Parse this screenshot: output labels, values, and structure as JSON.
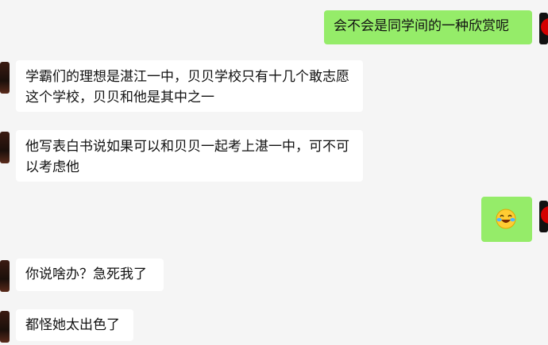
{
  "chat": {
    "messages": [
      {
        "side": "right",
        "text": "会不会是同学间的一种欣赏呢"
      },
      {
        "side": "left",
        "text": "学霸们的理想是湛江一中，贝贝学校只有十几个敢志愿这个学校，贝贝和他是其中之一"
      },
      {
        "side": "left",
        "text": "他写表白书说如果可以和贝贝一起考上湛一中，可不可以考虑他"
      },
      {
        "side": "right",
        "emoji": "laughing-crying-emoji"
      },
      {
        "side": "left",
        "text": "你说啥办？急死我了"
      },
      {
        "side": "left",
        "text": "都怪她太出色了"
      }
    ]
  },
  "colors": {
    "background": "#f5f5f5",
    "incoming_bubble": "#ffffff",
    "outgoing_bubble": "#95ec69"
  }
}
